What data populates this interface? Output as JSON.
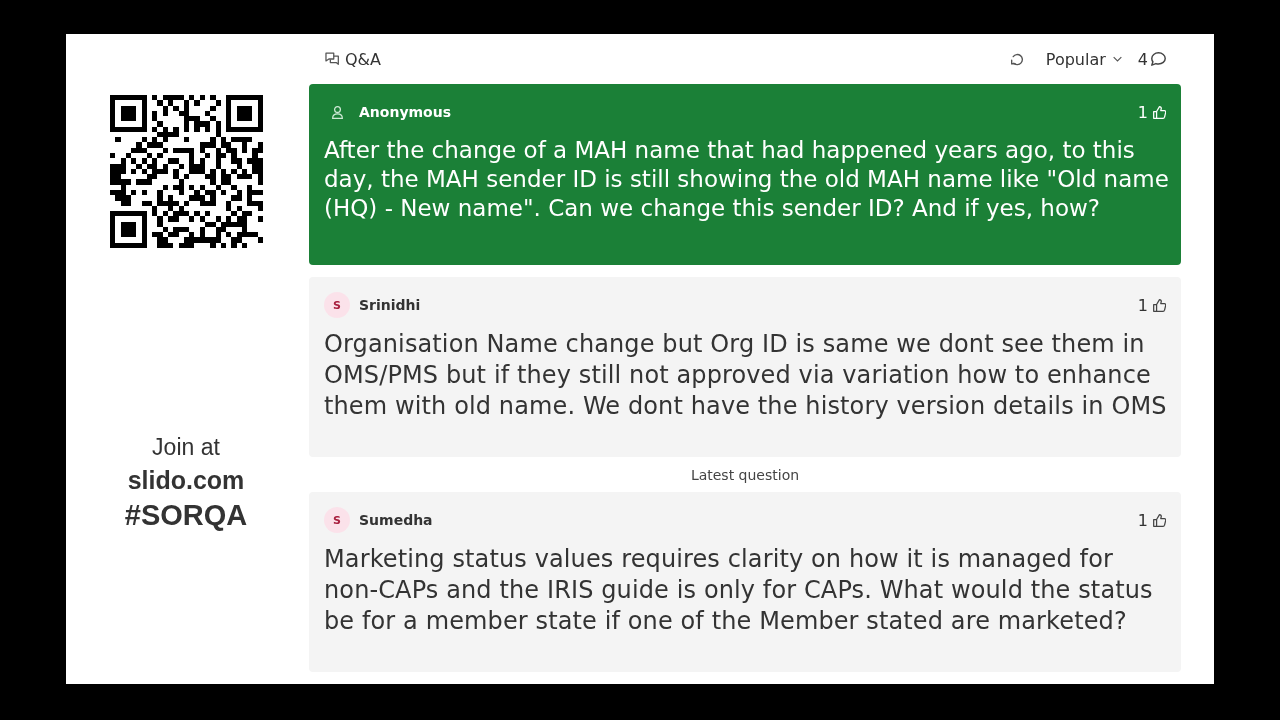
{
  "header": {
    "title": "Q&A",
    "sort": "Popular",
    "count": "4"
  },
  "sidebar": {
    "join_label": "Join at",
    "url": "slido.com",
    "code": "#SORQA"
  },
  "feed": [
    {
      "kind": "question",
      "author": "Anonymous",
      "highlighted": true,
      "likes": "1",
      "text": "After the change of a MAH name that had happened years ago, to this day, the MAH sender ID is still showing the old MAH name like \"Old name (HQ) - New name\". Can we change this sender ID? And if yes, how?"
    },
    {
      "kind": "question",
      "author": "Srinidhi",
      "initial": "S",
      "highlighted": false,
      "likes": "1",
      "text": "Organisation Name change but Org ID is same we dont see them in OMS/PMS but if they still not approved via variation how to enhance them with old name. We dont have the history version details in OMS"
    },
    {
      "kind": "divider",
      "label": "Latest question"
    },
    {
      "kind": "question",
      "author": "Sumedha",
      "initial": "S",
      "highlighted": false,
      "likes": "1",
      "text": "Marketing status values requires clarity on how it is managed for non-CAPs and the IRIS guide is only for CAPs. What would the status be for a member state if one of the Member stated are marketed?"
    }
  ]
}
